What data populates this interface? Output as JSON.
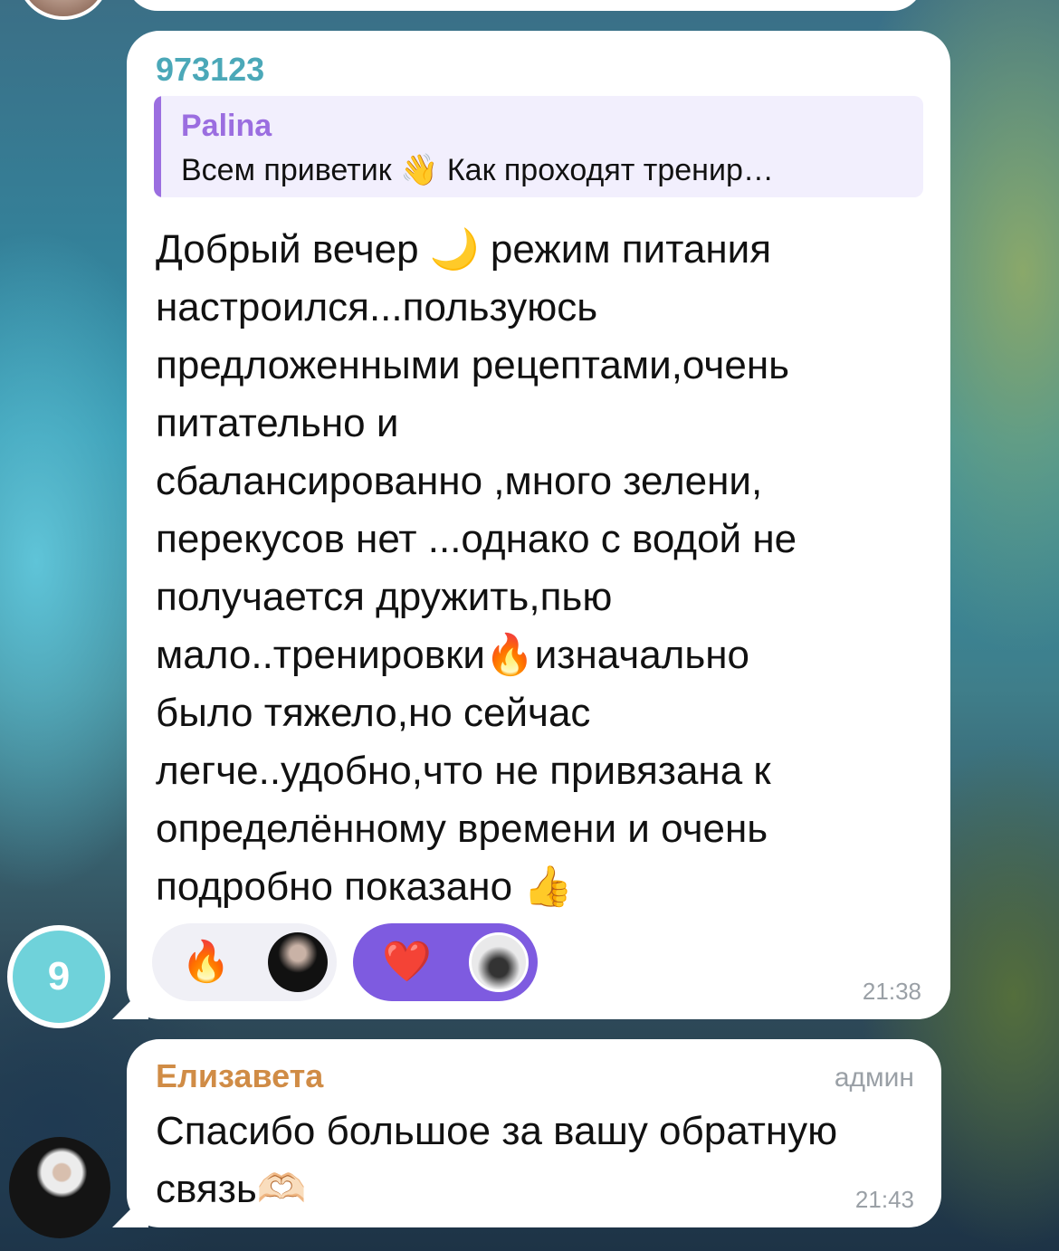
{
  "message1": {
    "sender": "973123",
    "reply": {
      "author": "Palina",
      "text": "Всем приветик 👋 Как проходят тренир…"
    },
    "text": "Добрый вечер 🌙 режим питания\nнастроился...пользуюсь\nпредложенными рецептами,очень\nпитательно и\nсбалансированно ,много зелени,\nперекусов нет ...однако с водой не\nполучается дружить,пью\nмало..тренировки🔥изначально\nбыло тяжело,но сейчас\nлегче..удобно,что не привязана к\nопределённому времени и очень\nподробно показано 👍",
    "reactions": [
      {
        "emoji": "🔥",
        "avatar_icon": "user-avatar"
      },
      {
        "emoji": "❤️",
        "avatar_icon": "user-avatar"
      }
    ],
    "time": "21:38",
    "unread_count": "9"
  },
  "message2": {
    "sender": "Елизавета",
    "role": "админ",
    "text": "Спасибо большое за вашу обратную\nсвязь🫶🏻",
    "time": "21:43"
  },
  "colors": {
    "sender1": "#4ba8b8",
    "reply_accent": "#9b6ee0",
    "sender2": "#d08c46",
    "heart_reaction_bg": "#7e5be0",
    "unread_badge": "#6fd2da"
  }
}
